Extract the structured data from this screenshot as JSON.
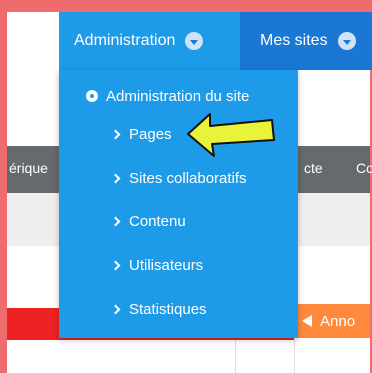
{
  "navbar": {
    "admin_label": "Administration",
    "mysites_label": "Mes sites"
  },
  "background": {
    "gray_left_text": "érique",
    "gray_mid_text": "cte",
    "gray_right_text": "Co",
    "announcement_tab": "Anno"
  },
  "dropdown": {
    "header": "Administration du site",
    "items": [
      {
        "label": "Pages"
      },
      {
        "label": "Sites collaboratifs"
      },
      {
        "label": "Contenu"
      },
      {
        "label": "Utilisateurs"
      },
      {
        "label": "Statistiques"
      }
    ]
  },
  "colors": {
    "frame": "#ee6b6e",
    "navbar": "#1a78d4",
    "dropdown": "#1e9be8",
    "pointer_arrow": "#e8f33a"
  }
}
